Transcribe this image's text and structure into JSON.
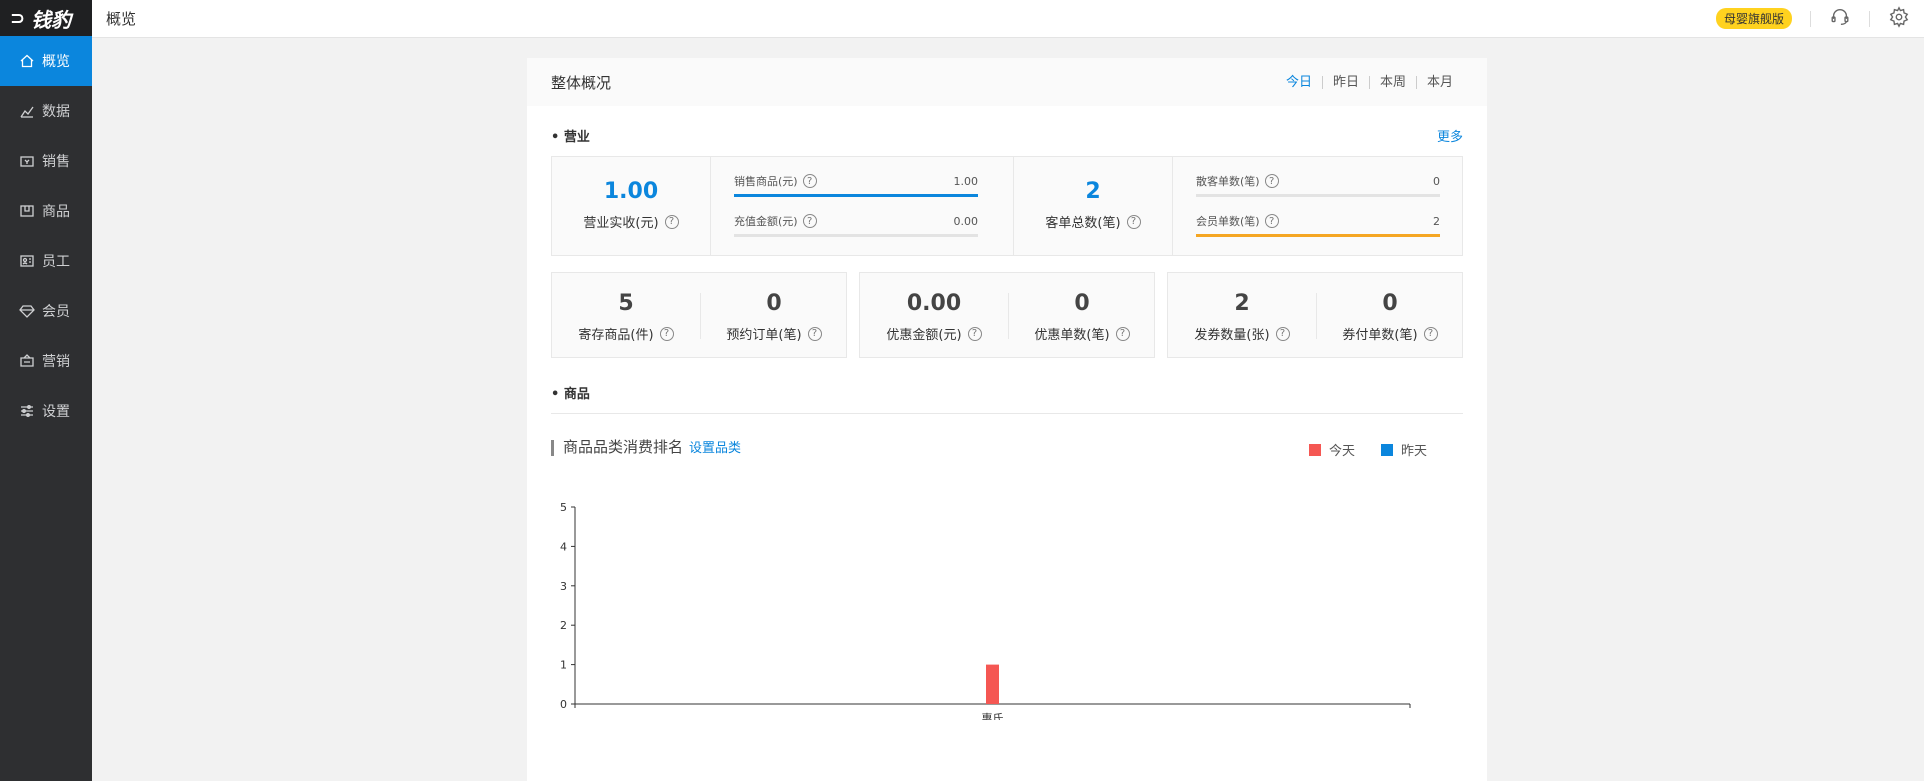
{
  "app": {
    "logo_text": "钱豹",
    "page_title": "概览"
  },
  "sidebar": {
    "items": [
      {
        "label": "概览",
        "icon": "home-icon",
        "active": true
      },
      {
        "label": "数据",
        "icon": "data-chart-icon"
      },
      {
        "label": "销售",
        "icon": "sales-icon"
      },
      {
        "label": "商品",
        "icon": "product-icon"
      },
      {
        "label": "员工",
        "icon": "employee-icon"
      },
      {
        "label": "会员",
        "icon": "diamond-icon"
      },
      {
        "label": "营销",
        "icon": "marketing-icon"
      },
      {
        "label": "设置",
        "icon": "settings-sliders-icon"
      }
    ]
  },
  "topbar": {
    "edition_badge": "母婴旗舰版",
    "support_icon": "headset-icon",
    "settings_icon": "gear-icon"
  },
  "panel": {
    "title": "整体概况",
    "tabs": [
      "今日",
      "昨日",
      "本周",
      "本月"
    ],
    "active_tab": "今日",
    "business_section": "营业",
    "more_link": "更多",
    "revenue": {
      "value": "1.00",
      "label": "营业实收(元)"
    },
    "revenue_breakdown": [
      {
        "label": "销售商品(元)",
        "value": "1.00",
        "ratio": 1.0,
        "color": "#0b86dd"
      },
      {
        "label": "充值金额(元)",
        "value": "0.00",
        "ratio": 0,
        "color": "#0b86dd"
      }
    ],
    "orders": {
      "value": "2",
      "label": "客单总数(笔)"
    },
    "orders_breakdown": [
      {
        "label": "散客单数(笔)",
        "value": "0",
        "ratio": 0,
        "color": "#f5a623"
      },
      {
        "label": "会员单数(笔)",
        "value": "2",
        "ratio": 1.0,
        "color": "#f5a623"
      }
    ],
    "small_metrics": [
      {
        "value": "5",
        "label": "寄存商品(件)"
      },
      {
        "value": "0",
        "label": "预约订单(笔)"
      },
      {
        "value": "0.00",
        "label": "优惠金额(元)"
      },
      {
        "value": "0",
        "label": "优惠单数(笔)"
      },
      {
        "value": "2",
        "label": "发券数量(张)"
      },
      {
        "value": "0",
        "label": "券付单数(笔)"
      }
    ],
    "product_section": "商品",
    "chart_title": "商品品类消费排名",
    "chart_link": "设置品类",
    "legend": [
      {
        "name": "今天",
        "color": "#f55753"
      },
      {
        "name": "昨天",
        "color": "#0b86dd"
      }
    ]
  },
  "chart_data": {
    "type": "bar",
    "categories": [
      "惠氏"
    ],
    "series": [
      {
        "name": "今天",
        "values": [
          1
        ],
        "color": "#f55753"
      },
      {
        "name": "昨天",
        "values": [
          0
        ],
        "color": "#0b86dd"
      }
    ],
    "ylim": [
      0,
      5
    ],
    "yticks": [
      "0",
      "1",
      "2",
      "3",
      "4",
      "5"
    ],
    "grid": false
  }
}
